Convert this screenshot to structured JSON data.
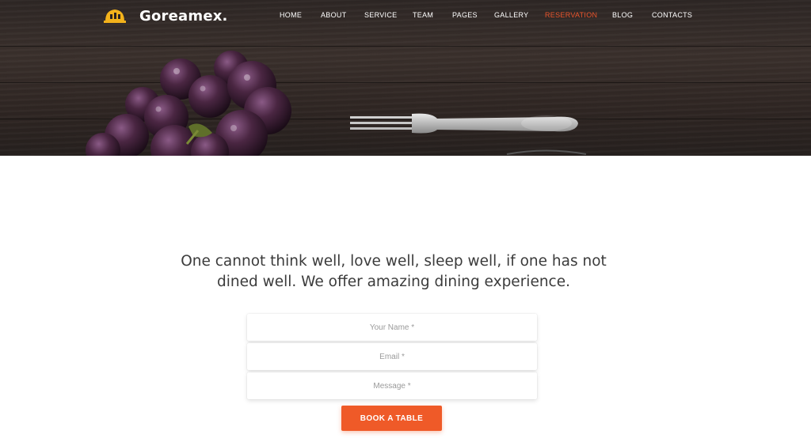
{
  "brand": {
    "name": "Goreamex.",
    "icon": "building-hat-logo-icon",
    "accent": "#f3b21b"
  },
  "nav": {
    "items": [
      {
        "label": "HOME",
        "active": false
      },
      {
        "label": "ABOUT",
        "active": false
      },
      {
        "label": "SERVICE",
        "active": false
      },
      {
        "label": "TEAM",
        "active": false
      },
      {
        "label": "PAGES",
        "active": false
      },
      {
        "label": "GALLERY",
        "active": false
      },
      {
        "label": "RESERVATION",
        "active": true
      },
      {
        "label": "BLOG",
        "active": false
      },
      {
        "label": "CONTACTS",
        "active": false
      }
    ],
    "active_color": "#e8532b"
  },
  "hero": {
    "image": "grapes-and-fork-on-wooden-table"
  },
  "main": {
    "headline": "One cannot think well, love well, sleep well, if one has not dined well. We offer amazing dining experience."
  },
  "form": {
    "name_placeholder": "Your Name *",
    "email_placeholder": "Email *",
    "message_placeholder": "Message *",
    "submit_label": "BOOK A TABLE",
    "button_color": "#ef5a28"
  }
}
